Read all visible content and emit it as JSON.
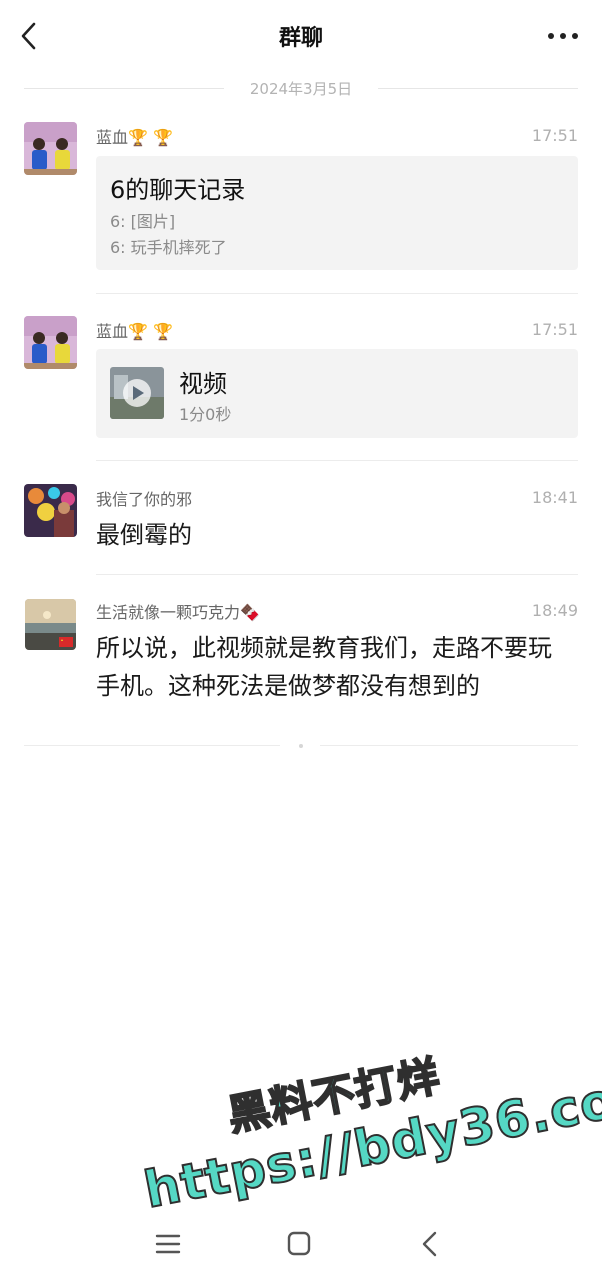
{
  "header": {
    "title": "群聊"
  },
  "date_separator": "2024年3月5日",
  "messages": [
    {
      "sender": "蓝血🏆 🏆",
      "time": "17:51",
      "record": {
        "title": "6的聊天记录",
        "lines": [
          "6: [图片]",
          "6: 玩手机摔死了"
        ]
      }
    },
    {
      "sender": "蓝血🏆 🏆",
      "time": "17:51",
      "video": {
        "title": "视频",
        "duration": "1分0秒"
      }
    },
    {
      "sender": "我信了你的邪",
      "time": "18:41",
      "text": "最倒霉的"
    },
    {
      "sender": "生活就像一颗巧克力🍫",
      "time": "18:49",
      "text": "所以说，此视频就是教育我们，走路不要玩手机。这种死法是做梦都没有想到的"
    }
  ],
  "watermark": {
    "line1": "黑料不打烊",
    "line2": "https://bdy36.co"
  },
  "colors": {
    "watermark": "#55d8c4",
    "card_bg": "#f3f3f3"
  },
  "icons": {
    "back": "chevron-left-icon",
    "more": "more-dots-icon",
    "nav_menu": "menu-icon",
    "nav_home": "home-square-icon",
    "nav_back": "nav-back-icon"
  }
}
